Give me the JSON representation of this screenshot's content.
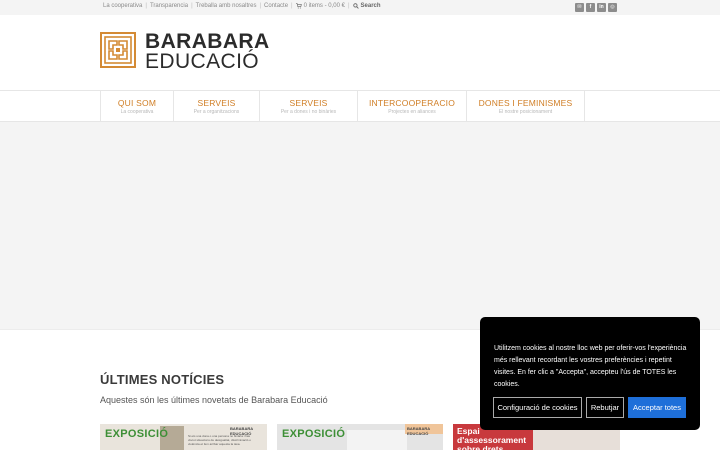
{
  "topbar": {
    "links": [
      "La cooperativa",
      "Transparencia",
      "Treballa amb nosaltres",
      "Contacte"
    ],
    "cart": "0 items - 0,00 €",
    "search": "Search",
    "social_icons": [
      "email-icon",
      "facebook-icon",
      "linkedin-icon",
      "instagram-icon"
    ]
  },
  "logo": {
    "line1": "BARABARA",
    "line2": "EDUCACIÓ",
    "brand_color": "#d48a34"
  },
  "nav": {
    "items": [
      {
        "title": "QUI SOM",
        "sub": "La cooperativa"
      },
      {
        "title": "SERVEIS",
        "sub": "Per a organitzacions"
      },
      {
        "title": "SERVEIS",
        "sub": "Per a dones i no binàries"
      },
      {
        "title": "INTERCOOPERACIO",
        "sub": "Projectes en aliances"
      },
      {
        "title": "DONES I FEMINISMES",
        "sub": "El nostre posicionament"
      }
    ],
    "accent": "#d07e25"
  },
  "news": {
    "title": "ÚLTIMES NOTÍCIES",
    "subtitle": "Aquestes són les últimes novetats de Barabara Educació",
    "cards": [
      {
        "label": "EXPOSICIÓ",
        "brand": "BARABARA EDUCACIÓ",
        "note": "Si ets una dona o una persona no binària i has viscut situacions de desigualtat, discriminació o violència et fem arribar aquesta la tava."
      },
      {
        "label": "EXPOSICIÓ",
        "brand": "BARABARA EDUCACIÓ"
      },
      {
        "label": "Espai d'assessorament sobre drets"
      }
    ]
  },
  "cookie": {
    "text": "Utilitzem cookies al nostre lloc web per oferir-vos l'experiència més rellevant recordant les vostres preferències i repetint visites. En fer clic a \"Accepta\", accepteu l'ús de TOTES les cookies.",
    "config_label": "Configuració de cookies",
    "reject_label": "Rebutjar",
    "accept_label": "Acceptar totes",
    "accept_color": "#1e6fd9"
  }
}
